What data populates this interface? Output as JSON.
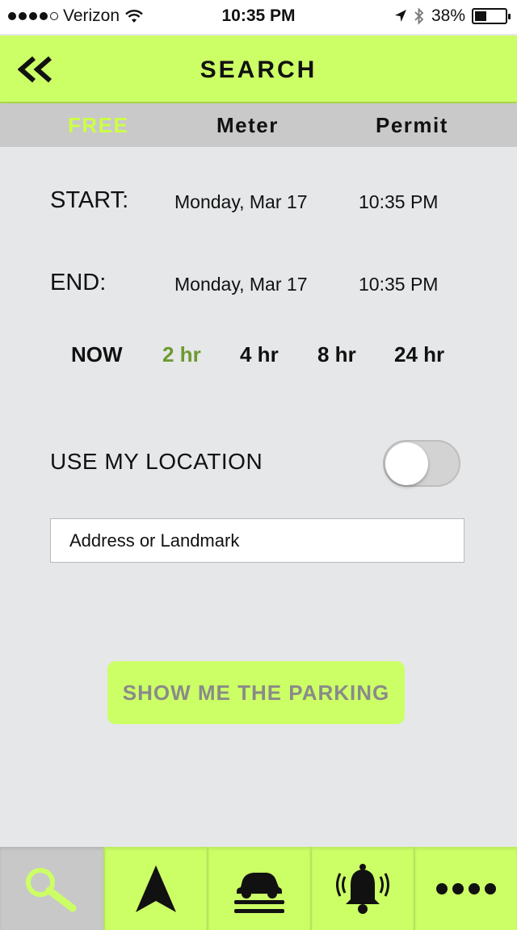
{
  "status_bar": {
    "carrier": "Verizon",
    "time": "10:35 PM",
    "battery": "38%",
    "battery_level": 0.38,
    "signal_icon": "signal-dots-icon",
    "wifi_icon": "wifi-icon",
    "location_icon": "location-arrow-icon",
    "bluetooth_icon": "bluetooth-icon"
  },
  "header": {
    "title": "SEARCH",
    "back_icon": "double-chevron-left-icon"
  },
  "tabs": [
    {
      "label": "FREE",
      "active": true
    },
    {
      "label": "Meter",
      "active": false
    },
    {
      "label": "Permit",
      "active": false
    }
  ],
  "start": {
    "label": "START:",
    "date": "Monday, Mar 17",
    "time": "10:35 PM"
  },
  "end": {
    "label": "END:",
    "date": "Monday, Mar 17",
    "time": "10:35 PM"
  },
  "durations": [
    {
      "label": "NOW",
      "active": false
    },
    {
      "label": "2 hr",
      "active": true
    },
    {
      "label": "4 hr",
      "active": false
    },
    {
      "label": "8 hr",
      "active": false
    },
    {
      "label": "24 hr",
      "active": false
    }
  ],
  "location": {
    "label": "USE MY LOCATION",
    "enabled": false
  },
  "address": {
    "placeholder": "Address or Landmark",
    "value": ""
  },
  "action_button": {
    "label": "SHOW ME THE PARKING"
  },
  "tabbar": [
    {
      "icon": "search-icon",
      "active": true
    },
    {
      "icon": "navigation-arrow-icon",
      "active": false
    },
    {
      "icon": "car-icon",
      "active": false
    },
    {
      "icon": "alarm-bell-icon",
      "active": false
    },
    {
      "icon": "more-dots-icon",
      "active": false
    }
  ],
  "colors": {
    "accent": "#ccff66",
    "active_tab_text": "#ccff44",
    "active_duration": "#6c9a2f",
    "background": "#e6e7e9",
    "tab_strip": "#c9c9c9",
    "button_text": "#8a8a8a"
  }
}
